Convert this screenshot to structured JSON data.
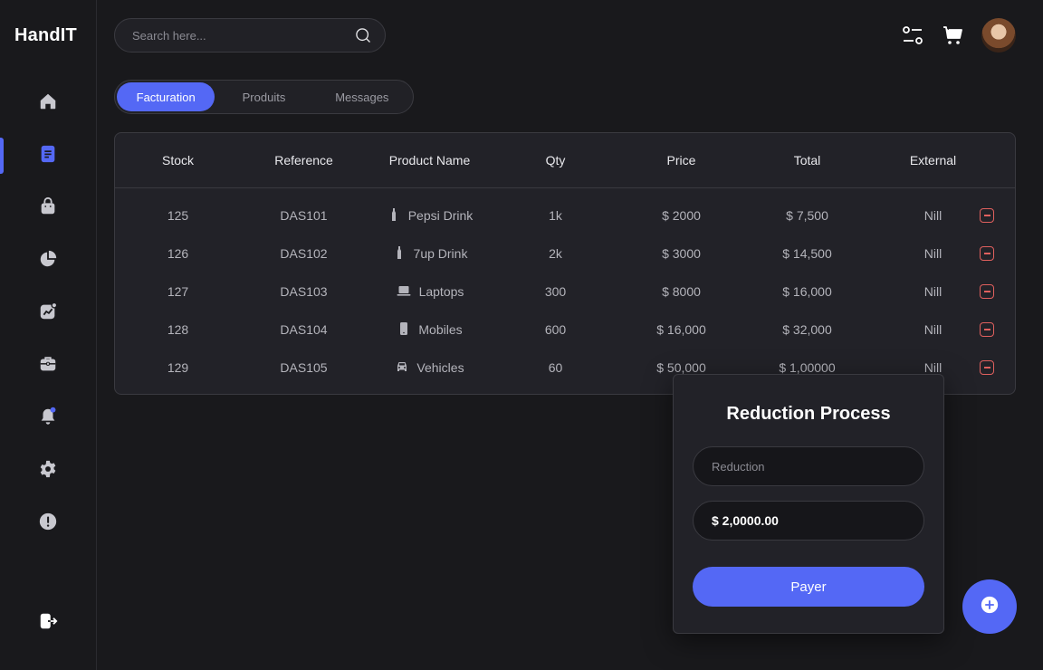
{
  "app": {
    "logo": "HandIT"
  },
  "sidebar": {
    "items": [
      {
        "icon": "home-icon"
      },
      {
        "icon": "document-icon",
        "active": true
      },
      {
        "icon": "shopping-bag-icon"
      },
      {
        "icon": "pie-chart-icon"
      },
      {
        "icon": "trend-chart-icon"
      },
      {
        "icon": "briefcase-icon"
      },
      {
        "icon": "bell-icon"
      },
      {
        "icon": "gear-icon"
      },
      {
        "icon": "alert-icon"
      },
      {
        "icon": "logout-icon"
      }
    ]
  },
  "search": {
    "placeholder": "Search here..."
  },
  "tabs": [
    {
      "label": "Facturation",
      "active": true
    },
    {
      "label": "Produits"
    },
    {
      "label": "Messages"
    }
  ],
  "table": {
    "headers": [
      "Stock",
      "Reference",
      "Product Name",
      "Qty",
      "Price",
      "Total",
      "External"
    ],
    "rows": [
      {
        "stock": "125",
        "reference": "DAS101",
        "product": "Pepsi Drink",
        "icon": "bottle-icon",
        "qty": "1k",
        "price": "$ 2000",
        "total": "$ 7,500",
        "external": "Nill"
      },
      {
        "stock": "126",
        "reference": "DAS102",
        "product": "7up Drink",
        "icon": "bottle-icon",
        "qty": "2k",
        "price": "$ 3000",
        "total": "$ 14,500",
        "external": "Nill"
      },
      {
        "stock": "127",
        "reference": "DAS103",
        "product": "Laptops",
        "icon": "laptop-icon",
        "qty": "300",
        "price": "$ 8000",
        "total": "$ 16,000",
        "external": "Nill"
      },
      {
        "stock": "128",
        "reference": "DAS104",
        "product": "Mobiles",
        "icon": "mobile-icon",
        "qty": "600",
        "price": "$ 16,000",
        "total": "$ 32,000",
        "external": "Nill"
      },
      {
        "stock": "129",
        "reference": "DAS105",
        "product": "Vehicles",
        "icon": "car-icon",
        "qty": "60",
        "price": "$ 50,000",
        "total": "$ 1,00000",
        "external": "Nill"
      }
    ]
  },
  "modal": {
    "title": "Reduction Process",
    "reduction_placeholder": "Reduction",
    "amount_value": "$ 2,0000.00",
    "pay_label": "Payer"
  },
  "colors": {
    "accent": "#5468f5",
    "danger": "#e0605e",
    "background": "#19191c",
    "notification_dot": "#5468f5"
  }
}
